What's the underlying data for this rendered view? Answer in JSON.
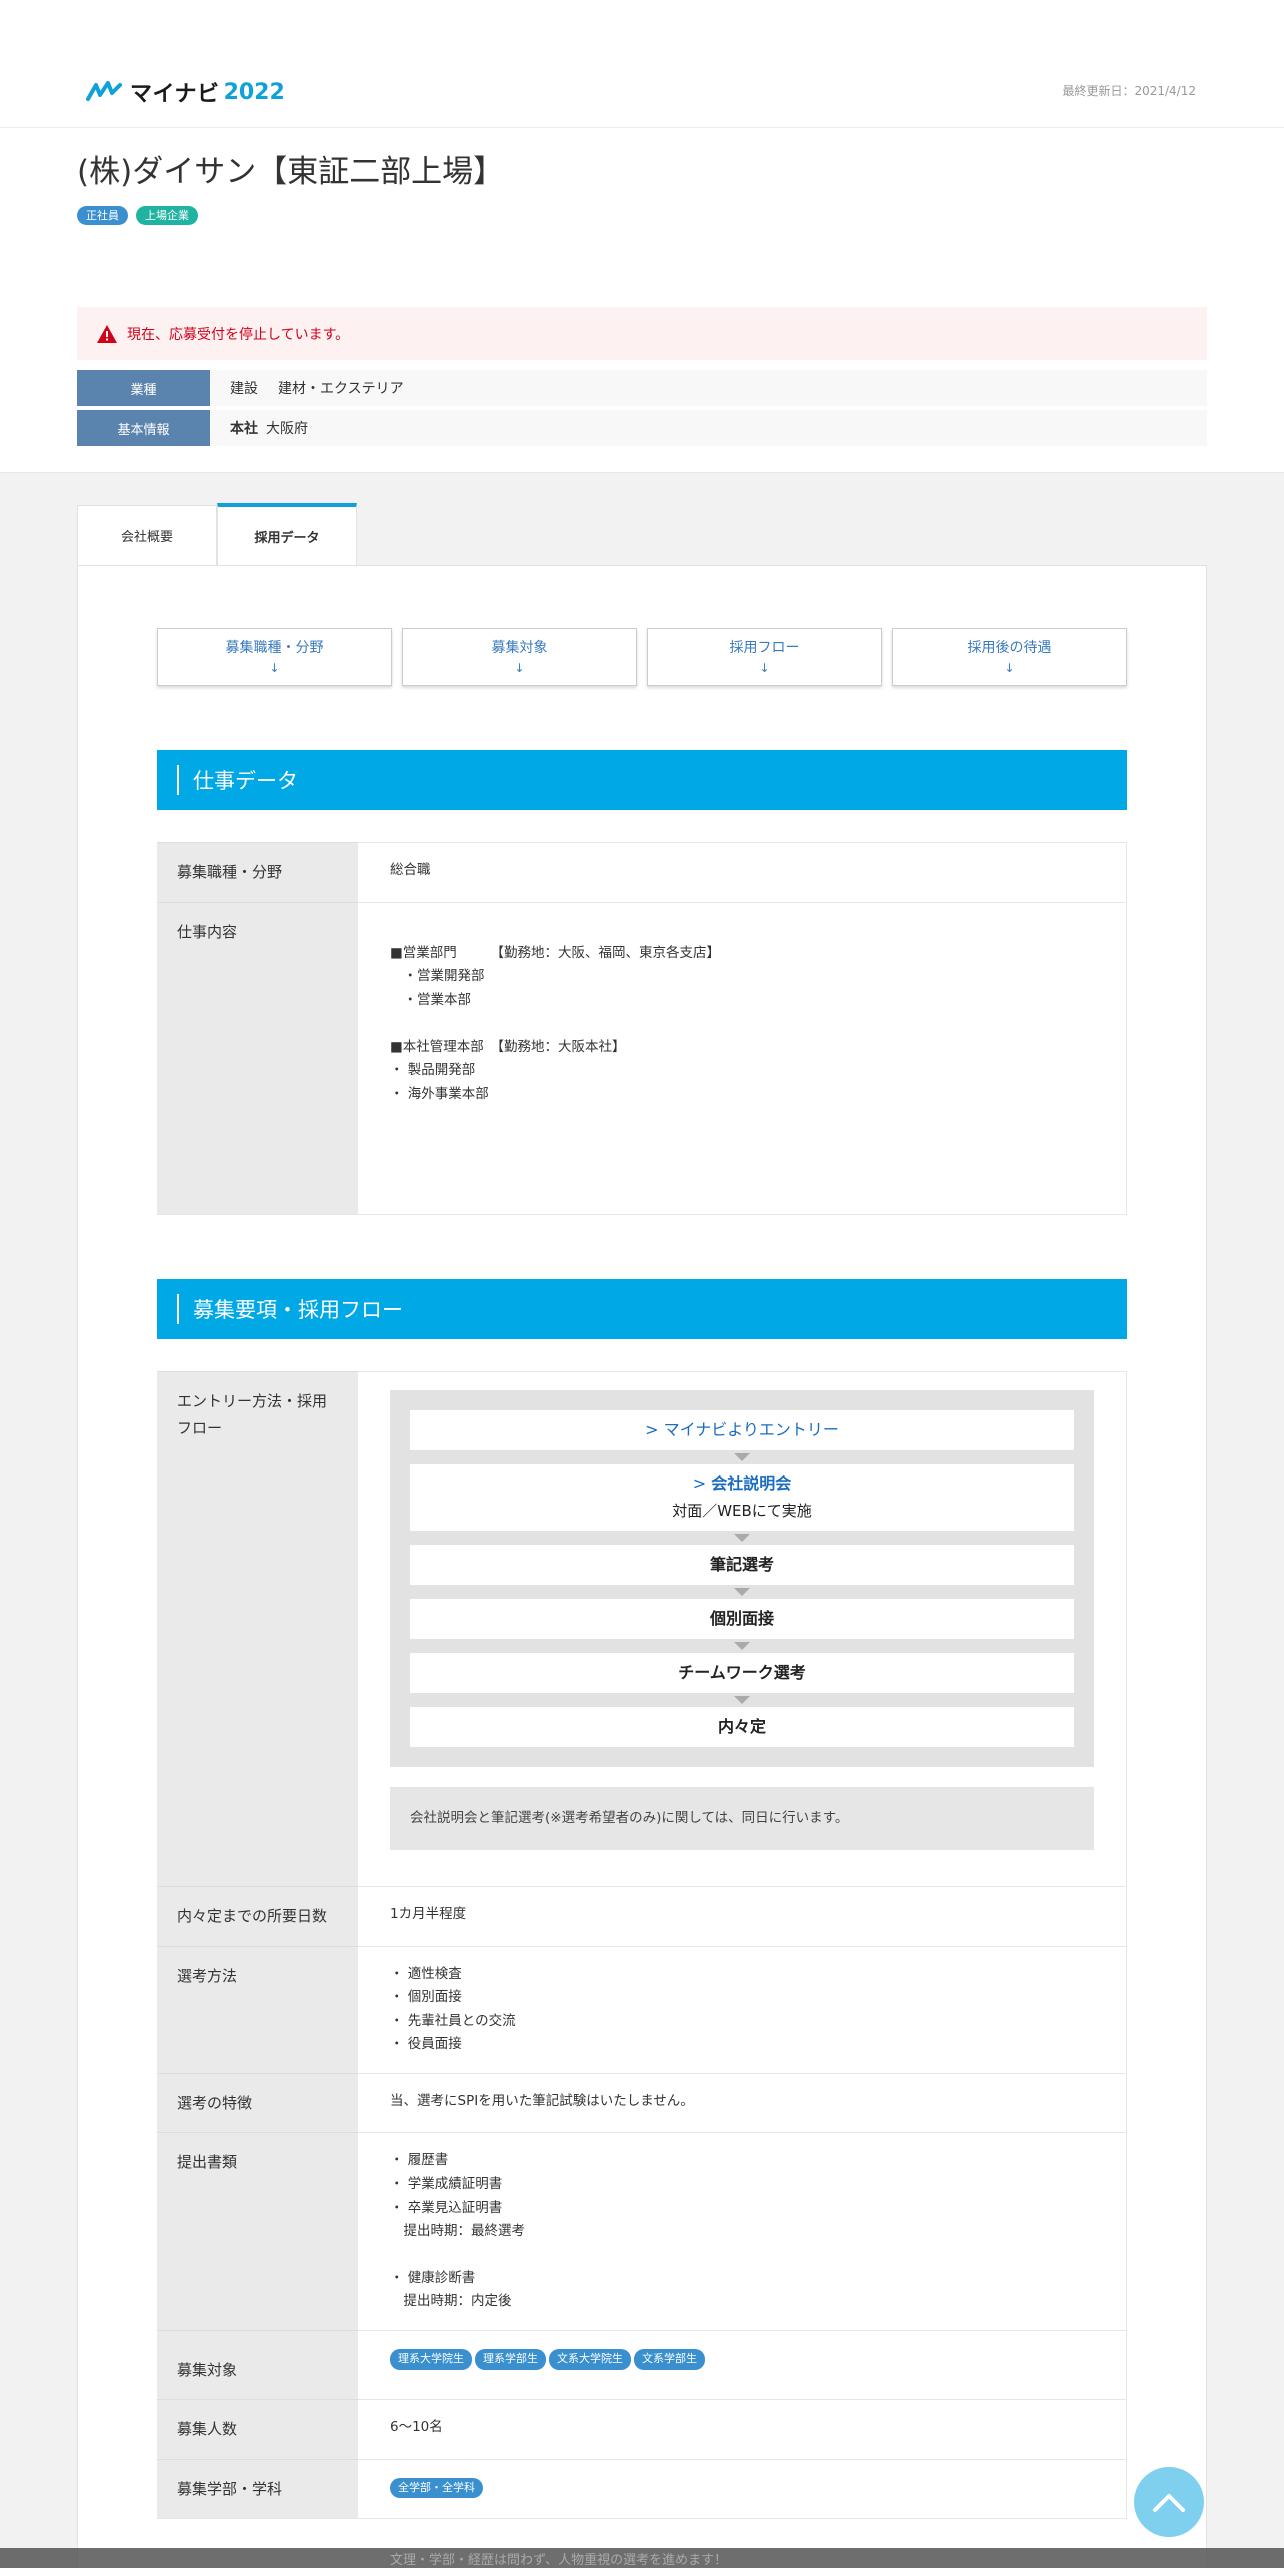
{
  "header": {
    "logo_brand": "マイナビ",
    "logo_year": "2022",
    "updated": "最終更新日：2021/4/12"
  },
  "company": {
    "name": "(株)ダイサン【東証二部上場】",
    "badges": [
      "正社員",
      "上場企業"
    ]
  },
  "alert": "現在、応募受付を停止しています。",
  "info": {
    "industry_label": "業種",
    "industry_values": [
      "建設",
      "建材・エクステリア"
    ],
    "basic_label": "基本情報",
    "basic_key": "本社",
    "basic_value": "大阪府"
  },
  "tabs": [
    "会社概要",
    "採用データ"
  ],
  "nav_buttons": [
    {
      "label": "募集職種・分野",
      "arrow": "↓"
    },
    {
      "label": "募集対象",
      "arrow": "↓"
    },
    {
      "label": "採用フロー",
      "arrow": "↓"
    },
    {
      "label": "採用後の待遇",
      "arrow": "↓"
    }
  ],
  "section1": {
    "title": "仕事データ",
    "rows": [
      {
        "label": "募集職種・分野",
        "value": "総合職"
      },
      {
        "label": "仕事内容",
        "lines": [
          "",
          "■営業部門　　　【勤務地：大阪、福岡、東京各支店】",
          "　・営業開発部",
          "　・営業本部",
          "",
          "■本社管理本部　【勤務地：大阪本社】",
          "・ 製品開発部",
          "・ 海外事業本部",
          "",
          "",
          "",
          ""
        ]
      }
    ]
  },
  "section2": {
    "title": "募集要項・採用フロー",
    "entry_label": "エントリー方法・採用フロー",
    "flow": {
      "step1_prefix": ">",
      "step1": "マイナビよりエントリー",
      "step2_prefix": ">",
      "step2": "会社説明会",
      "step2_sub": "対面／WEBにて実施",
      "step3": "筆記選考",
      "step4": "個別面接",
      "step5": "チームワーク選考",
      "step6": "内々定"
    },
    "flow_note": "会社説明会と筆記選考(※選考希望者のみ)に関しては、同日に行います。",
    "days_label": "内々定までの所要日数",
    "days_value": "1カ月半程度",
    "method_label": "選考方法",
    "method_lines": [
      "・ 適性検査",
      "・ 個別面接",
      "・ 先輩社員との交流",
      "・ 役員面接"
    ],
    "feature_label": "選考の特徴",
    "feature_value": "当、選考にSPIを用いた筆記試験はいたしません。",
    "docs_label": "提出書類",
    "docs_lines": [
      "・ 履歴書",
      "・ 学業成績証明書",
      "・ 卒業見込証明書",
      "　提出時期：最終選考",
      "",
      "・ 健康診断書",
      "　提出時期：内定後"
    ],
    "target_label": "募集対象",
    "target_tags": [
      "理系大学院生",
      "理系学部生",
      "文系大学院生",
      "文系学部生"
    ],
    "count_label": "募集人数",
    "count_value": "6～10名",
    "faculty_label": "募集学部・学科",
    "faculty_tag": "全学部・全学科"
  },
  "bottom_text": "文理・学部・経歴は問わず、人物重視の選考を進めます！"
}
